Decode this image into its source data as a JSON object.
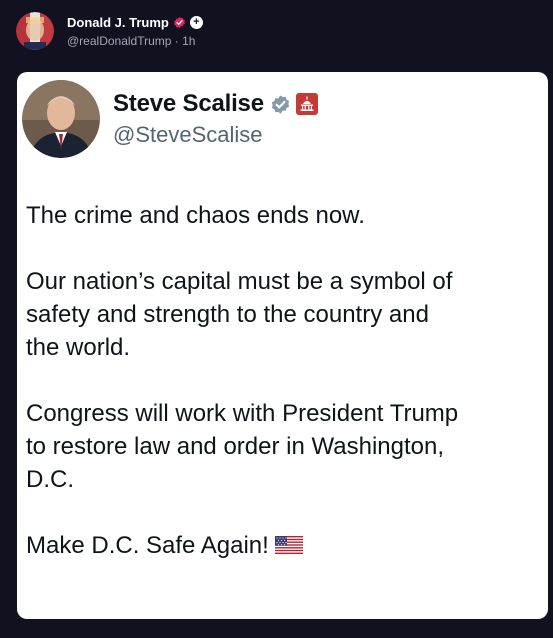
{
  "outer_post": {
    "author_name": "Donald J. Trump",
    "handle": "@realDonaldTrump",
    "time_separator": " · ",
    "time": "1h",
    "avatar_icon": "avatar-photo",
    "verified_badge_icon": "verified-badge-pink",
    "follow_icon": "plus-icon",
    "follow_glyph": "+"
  },
  "quoted_tweet": {
    "author_name": "Steve Scalise",
    "handle": "@SteveScalise",
    "verified_icon": "verified-badge-gray",
    "affiliation_icon": "capitol-building-icon",
    "lines": [
      "The crime and chaos ends now.",
      "",
      "Our nation’s capital must be a symbol of",
      "safety and strength to the country and",
      "the world.",
      "",
      "Congress will work with President Trump",
      "to restore law and order in Washington,",
      "D.C.",
      "",
      "Make D.C. Safe Again!"
    ],
    "trailing_emoji_icon": "us-flag-emoji"
  },
  "colors": {
    "frame_bg": "#11111f",
    "card_bg": "#ffffff",
    "text_primary": "#0f1419",
    "text_secondary": "#536471",
    "pink_badge": "#e0245e",
    "capitol_badge": "#c33a36"
  }
}
